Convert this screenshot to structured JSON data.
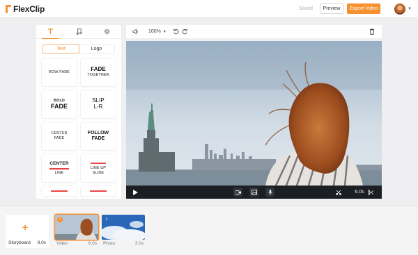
{
  "app": {
    "logo_text": "FlexClip"
  },
  "header": {
    "saved_label": "Saved",
    "preview_label": "Preview",
    "export_label": "Export Video",
    "accent": "#f7902f"
  },
  "left_panel": {
    "tabs": [
      "text-icon",
      "music-icon",
      "settings-icon"
    ],
    "segments": [
      "Text",
      "Logo"
    ],
    "tiles": [
      {
        "lines": [
          "ROW FADE"
        ]
      },
      {
        "lines": [
          "FADE",
          "TOGETHER"
        ]
      },
      {
        "lines": [
          "BOLD",
          "FADE"
        ]
      },
      {
        "lines": [
          "SLIP",
          "L-R"
        ]
      },
      {
        "lines": [
          "CENTER",
          "FADE"
        ]
      },
      {
        "lines": [
          "FOLLOW",
          "FADE"
        ]
      },
      {
        "lines": [
          "CENTER",
          "LINE"
        ]
      },
      {
        "lines": [
          "LINE UP",
          "SLIDE"
        ]
      }
    ]
  },
  "toolbar": {
    "zoom": "100%"
  },
  "player": {
    "duration": "6.0s"
  },
  "timeline": {
    "storyboard_label": "Storyboard",
    "storyboard_total": "9.0s",
    "clips": [
      {
        "index": "1",
        "label": "Video",
        "duration": "6.0s"
      },
      {
        "index": "2",
        "label": "Photo",
        "duration": "3.0s"
      }
    ]
  }
}
